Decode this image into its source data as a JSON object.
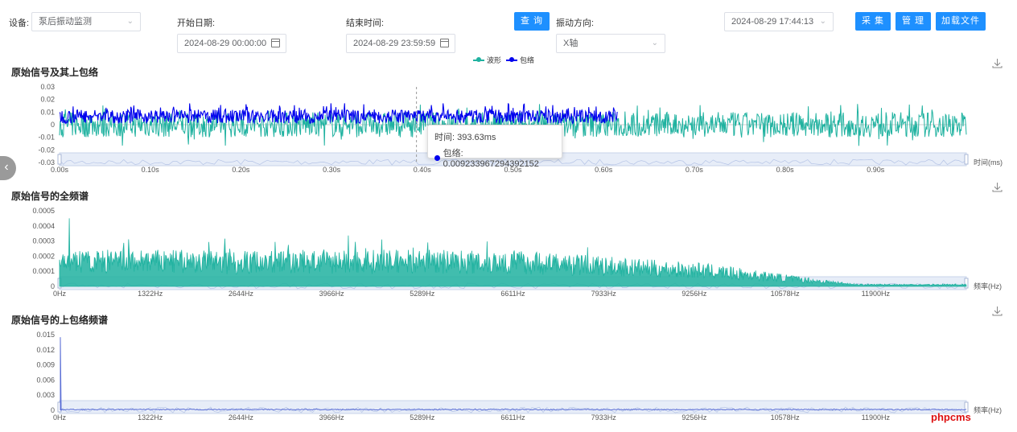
{
  "filters": {
    "device_label": "设备:",
    "device_value": "泵后振动监测",
    "start_label": "开始日期:",
    "start_value": "2024-08-29 00:00:00",
    "end_label": "结束时间:",
    "end_value": "2024-08-29 23:59:59",
    "query_button": "查 询",
    "direction_label": "振动方向:",
    "direction_value": "X轴",
    "capture_time": "2024-08-29 17:44:13",
    "collect_button": "采 集",
    "manage_button": "管 理",
    "load_button": "加载文件"
  },
  "legend": {
    "waveform": "波形",
    "envelope": "包络"
  },
  "colors": {
    "waveform": "#20b2a0",
    "envelope": "#0000ee",
    "spectrum": "#20b2a0",
    "envelope_spectrum": "#5b6fd6",
    "button": "#1e90ff",
    "slider": "#dbe4f5"
  },
  "icons": {
    "download": "download-icon",
    "prev": "chevron-left-icon",
    "calendar": "calendar-icon",
    "dropdown": "chevron-down-icon"
  },
  "watermark": "phpcms",
  "tooltip": {
    "time_text": "时间: 393.63ms",
    "env_text": "包络: 0.009233967294392152"
  },
  "chart_data": [
    {
      "type": "line",
      "title": "原始信号及其上包络",
      "xlabel": "时间(ms)",
      "ylim": [
        -0.03,
        0.03
      ],
      "xlim": [
        0,
        1.0
      ],
      "y_ticks": [
        "0.03",
        "0.02",
        "0.01",
        "0",
        "-0.01",
        "-0.02",
        "-0.03"
      ],
      "x_ticks": [
        "0.00s",
        "0.10s",
        "0.20s",
        "0.30s",
        "0.40s",
        "0.50s",
        "0.60s",
        "0.70s",
        "0.80s",
        "0.90s"
      ],
      "series": [
        {
          "name": "波形",
          "x_range": [
            0,
            1.0
          ],
          "y_range": [
            -0.02,
            0.015
          ]
        },
        {
          "name": "包络",
          "x_range": [
            0,
            0.615
          ],
          "y_range": [
            0.0,
            0.017
          ]
        }
      ],
      "cursor_x": 0.39363
    },
    {
      "type": "area",
      "title": "原始信号的全频谱",
      "xlabel": "频率(Hz)",
      "ylim": [
        0,
        0.0005
      ],
      "y_ticks": [
        "0.0005",
        "0.0004",
        "0.0003",
        "0.0002",
        "0.0001",
        "0"
      ],
      "x_ticks": [
        "0Hz",
        "1322Hz",
        "2644Hz",
        "3966Hz",
        "5289Hz",
        "6611Hz",
        "7933Hz",
        "9256Hz",
        "10578Hz",
        "11900Hz"
      ],
      "series": [
        {
          "peak": 0.00045,
          "peak_x": 220
        }
      ]
    },
    {
      "type": "line",
      "title": "原始信号的上包络频谱",
      "xlabel": "频率(Hz)",
      "ylim": [
        0,
        0.015
      ],
      "y_ticks": [
        "0.015",
        "0.012",
        "0.009",
        "0.006",
        "0.003",
        "0"
      ],
      "x_ticks": [
        "0Hz",
        "1322Hz",
        "2644Hz",
        "3966Hz",
        "5289Hz",
        "6611Hz",
        "7933Hz",
        "9256Hz",
        "10578Hz",
        "11900Hz"
      ],
      "series": [
        {
          "peak": 0.0145,
          "peak_x": 0
        }
      ]
    }
  ]
}
